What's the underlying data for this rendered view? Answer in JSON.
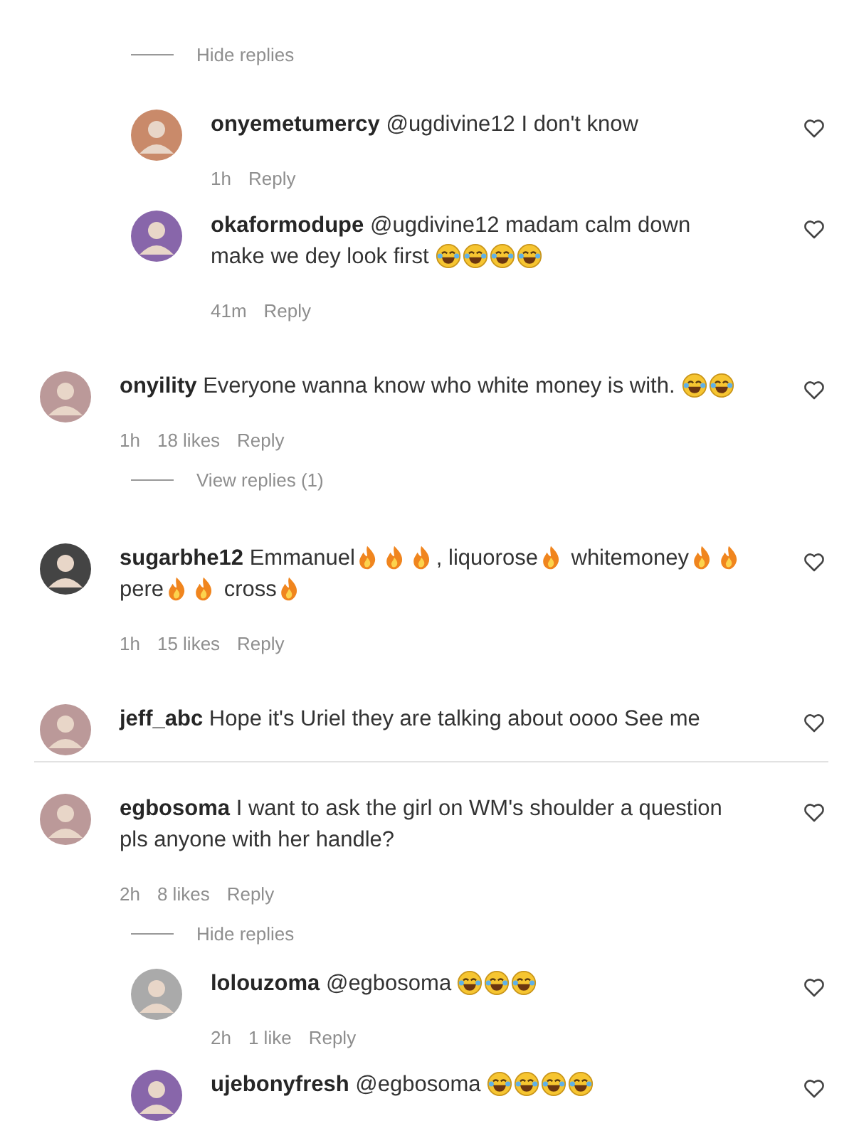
{
  "items": [
    {
      "kind": "replies",
      "toggle": "Hide replies",
      "replies": [
        {
          "user": "onyemetumercy",
          "body": [
            {
              "kind": "text",
              "text": "@ugdivine12 I don't know"
            }
          ],
          "time": "1h",
          "reply": "Reply"
        },
        {
          "user": "okaformodupe",
          "body": [
            {
              "kind": "text",
              "text": "@ugdivine12 madam calm down"
            },
            {
              "kind": "text",
              "text": "make we dey look first "
            },
            {
              "kind": "laugh"
            },
            {
              "kind": "laugh"
            },
            {
              "kind": "laugh"
            },
            {
              "kind": "laugh"
            }
          ],
          "time": "41m",
          "reply": "Reply"
        }
      ]
    },
    {
      "kind": "comment",
      "user": "onyility",
      "body": [
        {
          "kind": "text",
          "text": "Everyone wanna know who white money is with. "
        },
        {
          "kind": "laugh"
        },
        {
          "kind": "laugh"
        }
      ],
      "time": "1h",
      "likes": "18 likes",
      "reply": "Reply",
      "toggle": "View replies (1)"
    },
    {
      "kind": "comment",
      "user": "sugarbhe12",
      "body": [
        {
          "kind": "text",
          "text": "Emmanuel"
        },
        {
          "kind": "fire"
        },
        {
          "kind": "fire"
        },
        {
          "kind": "fire"
        },
        {
          "kind": "text",
          "text": ", liquorose"
        },
        {
          "kind": "fire"
        },
        {
          "kind": "text",
          "text": " whitemoney"
        },
        {
          "kind": "fire"
        },
        {
          "kind": "fire"
        },
        {
          "kind": "text",
          "text": " pere"
        },
        {
          "kind": "fire"
        },
        {
          "kind": "fire"
        },
        {
          "kind": "text",
          "text": " cross"
        },
        {
          "kind": "fire"
        }
      ],
      "time": "1h",
      "likes": "15 likes",
      "reply": "Reply"
    },
    {
      "kind": "comment",
      "user": "jeff_abc",
      "body": [
        {
          "kind": "text",
          "text": "Hope it's Uriel they are talking about oooo See me"
        }
      ]
    },
    {
      "kind": "divider"
    },
    {
      "kind": "comment",
      "user": "egbosoma",
      "body": [
        {
          "kind": "text",
          "text": "I want to ask the girl on WM's shoulder a question"
        },
        {
          "kind": "text",
          "text": "pls anyone with her handle?"
        }
      ],
      "time": "2h",
      "likes": "8 likes",
      "reply": "Reply",
      "toggle": "Hide replies",
      "replies": [
        {
          "user": "lolouzoma",
          "body": [
            {
              "kind": "text",
              "text": "@egbosoma "
            },
            {
              "kind": "laugh"
            },
            {
              "kind": "laugh"
            },
            {
              "kind": "laugh"
            }
          ],
          "time": "2h",
          "likes": "1 like",
          "reply": "Reply"
        },
        {
          "user": "ujebonyfresh",
          "body": [
            {
              "kind": "text",
              "text": "@egbosoma "
            },
            {
              "kind": "laugh"
            },
            {
              "kind": "laugh"
            },
            {
              "kind": "laugh"
            },
            {
              "kind": "laugh"
            }
          ]
        }
      ]
    }
  ]
}
